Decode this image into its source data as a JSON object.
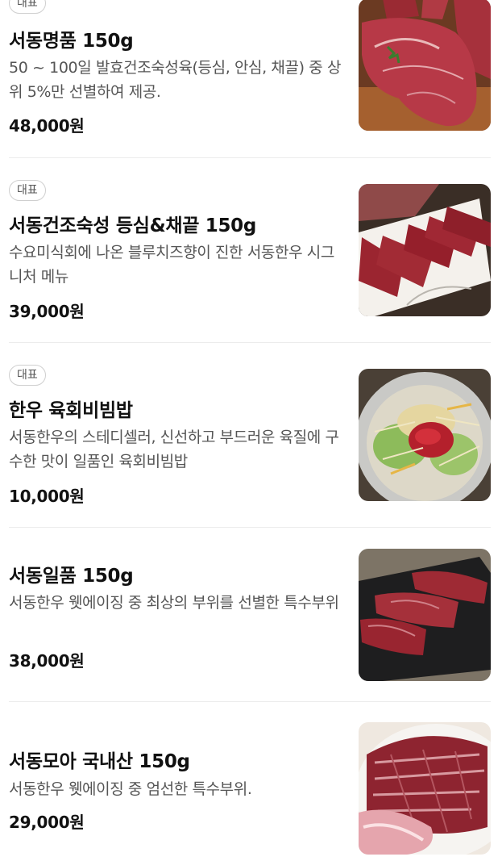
{
  "menu": [
    {
      "badge": "대표",
      "name": "서동명품 150g",
      "description": "50 ~ 100일 발효건조숙성육(등심, 안심, 채끌) 중 상위 5%만 선별하여 제공.",
      "price": "48,000원",
      "image_icon": "steak-photo"
    },
    {
      "badge": "대표",
      "name": "서동건조숙성 등심&채끝 150g",
      "description": "수요미식회에 나온 블루치즈향이 진한 서동한우 시그니처 메뉴",
      "price": "39,000원",
      "image_icon": "sliced-beef-plate-photo"
    },
    {
      "badge": "대표",
      "name": "한우 육회비빔밥",
      "description": "서동한우의 스테디셀러, 신선하고 부드러운 육질에 구수한 맛이 일품인 육회비빔밥",
      "price": "10,000원",
      "image_icon": "bibimbap-bowl-photo"
    },
    {
      "name": "서동일품 150g",
      "description": "서동한우 웻에이징 중 최상의 부위를 선별한 특수부위",
      "price": "38,000원",
      "image_icon": "beef-on-slate-photo"
    },
    {
      "name": "서동모아 국내산 150g",
      "description": "서동한우 웻에이징 중 엄선한 특수부위.",
      "price": "29,000원",
      "image_icon": "assorted-beef-platter-photo"
    }
  ]
}
